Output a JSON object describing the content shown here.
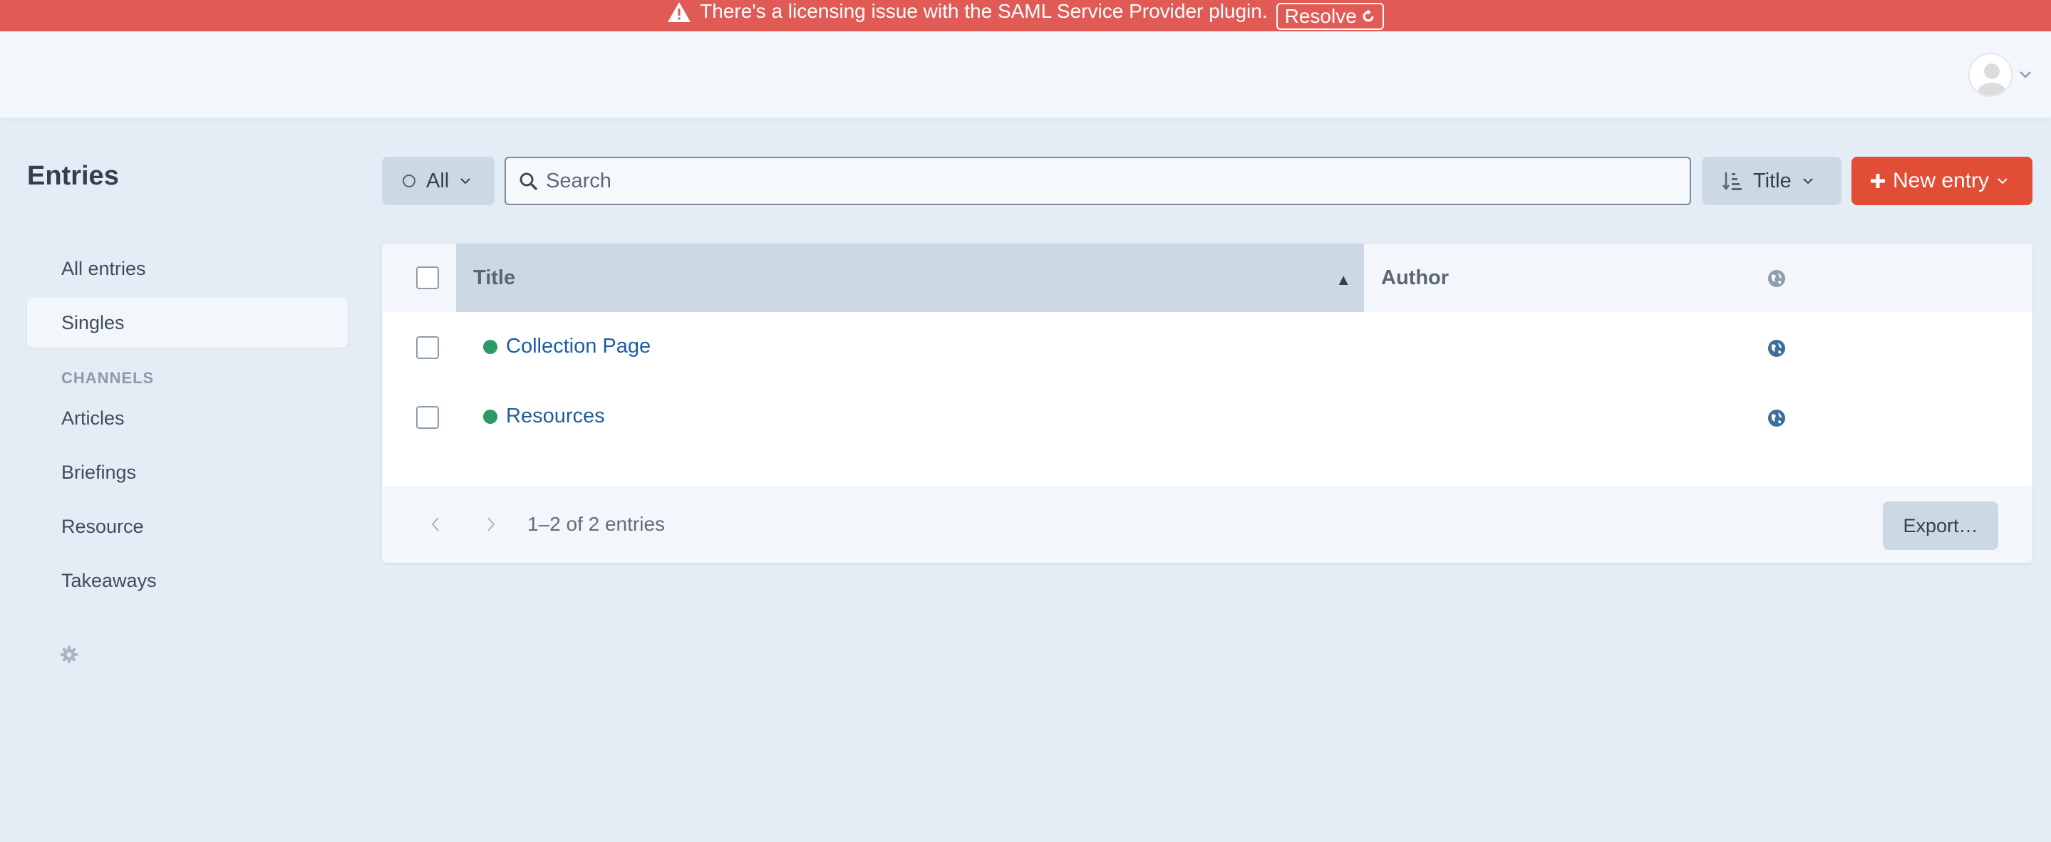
{
  "alert": {
    "message": "There's a licensing issue with the SAML Service Provider plugin.",
    "resolve_label": "Resolve",
    "icon": "warning-icon",
    "color": "#e05b55"
  },
  "header": {
    "avatar_icon": "user-avatar",
    "menu_icon": "chevron-down-icon"
  },
  "sidebar": {
    "title": "Entries",
    "items": [
      {
        "label": "All entries",
        "active": false
      },
      {
        "label": "Singles",
        "active": true
      }
    ],
    "channels_heading": "CHANNELS",
    "channels": [
      {
        "label": "Articles"
      },
      {
        "label": "Briefings"
      },
      {
        "label": "Resource"
      },
      {
        "label": "Takeaways"
      }
    ],
    "settings_icon": "gear-icon"
  },
  "toolbar": {
    "status_label": "All",
    "search_placeholder": "Search",
    "sort_label": "Title",
    "new_entry_label": "New entry",
    "accent_color": "#e14d35"
  },
  "table": {
    "columns": {
      "title": "Title",
      "author": "Author",
      "sites_icon": "globe-icon"
    },
    "sort_direction": "asc",
    "rows": [
      {
        "title": "Collection Page",
        "author": "",
        "status": "live",
        "status_color": "#2b9a66"
      },
      {
        "title": "Resources",
        "author": "",
        "status": "live",
        "status_color": "#2b9a66"
      }
    ],
    "pagination": "1–2 of 2 entries",
    "export_label": "Export…"
  }
}
